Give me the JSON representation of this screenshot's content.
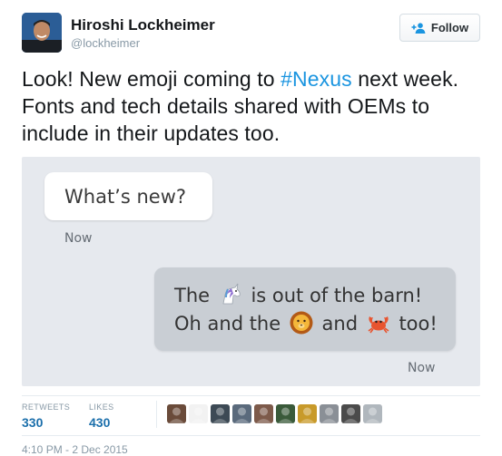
{
  "user": {
    "name": "Hiroshi Lockheimer",
    "handle": "@lockheimer"
  },
  "follow_label": "Follow",
  "tweet": {
    "text_pre": "Look! New emoji coming to ",
    "hashtag": "#Nexus",
    "text_post": " next week. Fonts and tech details shared with OEMs to include in their updates too."
  },
  "media": {
    "incoming_message": "What’s new?",
    "incoming_time": "Now",
    "outgoing": {
      "line1_a": "The",
      "line1_b": "is out of the barn!",
      "line2_a": "Oh and the",
      "line2_b": "and",
      "line2_c": "too!"
    },
    "outgoing_time": "Now"
  },
  "stats": {
    "retweets_label": "RETWEETS",
    "retweets_value": "330",
    "likes_label": "LIKES",
    "likes_value": "430"
  },
  "likers": [
    {
      "name": "liker-avatar-1",
      "color": "#6a4b3a"
    },
    {
      "name": "liker-avatar-2",
      "color": "#f2f2f2"
    },
    {
      "name": "liker-avatar-3",
      "color": "#3d4a55"
    },
    {
      "name": "liker-avatar-4",
      "color": "#5a6a7c"
    },
    {
      "name": "liker-avatar-5",
      "color": "#7d5a4a"
    },
    {
      "name": "liker-avatar-6",
      "color": "#3a5a3a"
    },
    {
      "name": "liker-avatar-7",
      "color": "#c89a2a"
    },
    {
      "name": "liker-avatar-8",
      "color": "#8a8f96"
    },
    {
      "name": "liker-avatar-9",
      "color": "#4b4b4b"
    },
    {
      "name": "liker-avatar-10",
      "color": "#b0b7bd"
    }
  ],
  "timestamp": "4:10 PM - 2 Dec 2015",
  "colors": {
    "link": "#1b95e0",
    "stat_value": "#1b6fab",
    "media_bg": "#e6e9ee"
  }
}
